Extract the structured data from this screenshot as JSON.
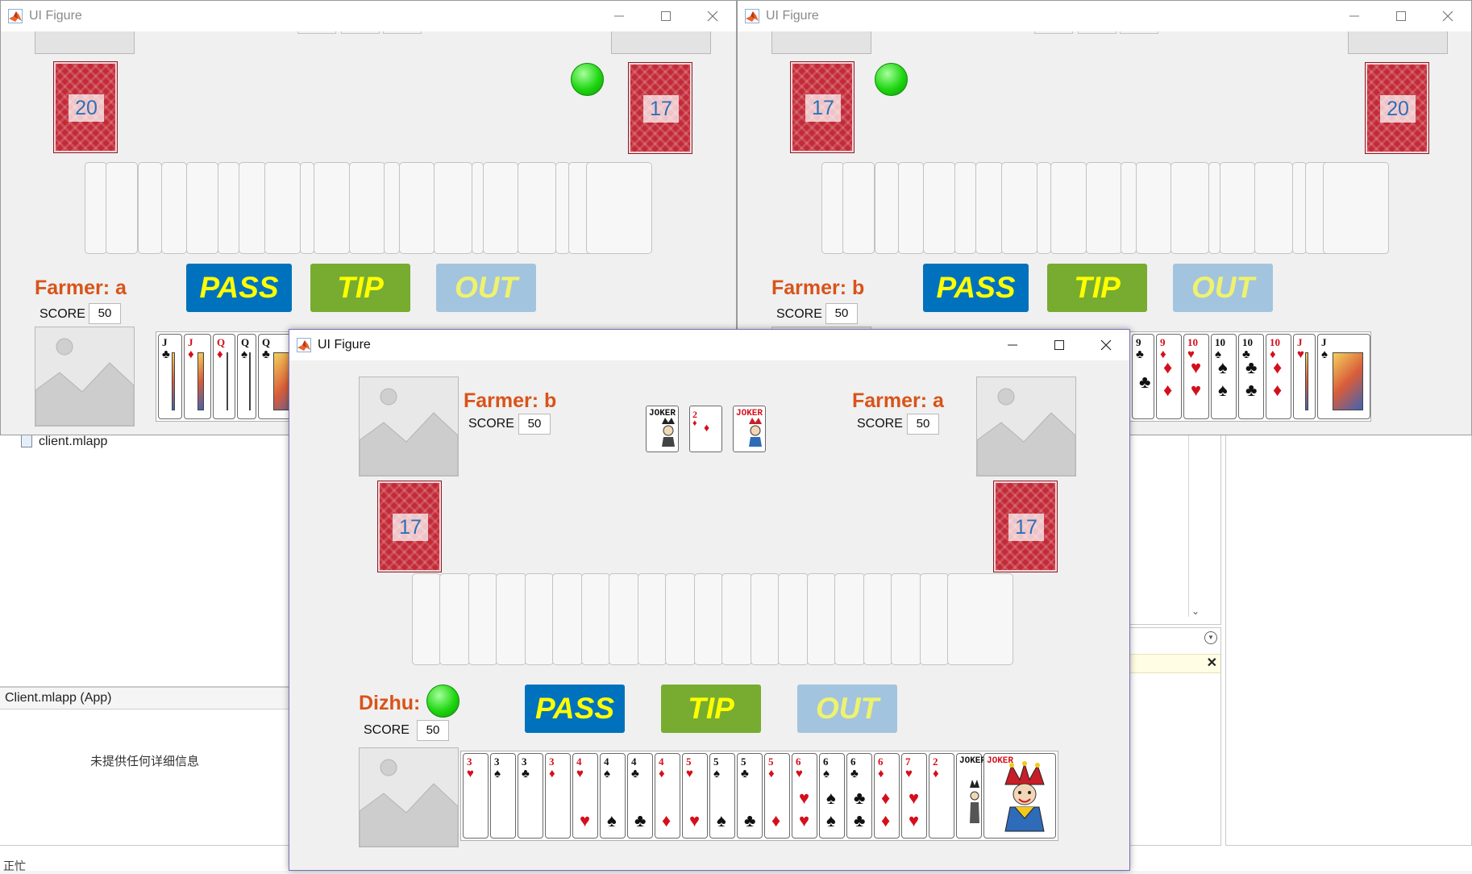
{
  "ide": {
    "file_item": "client.mlapp",
    "details_header": "Client.mlapp  (App)",
    "details_text": "未提供任何详细信息",
    "status": "正忙"
  },
  "windows": {
    "left": {
      "title": "UI Figure",
      "player_role": "Farmer: a",
      "score_label": "SCORE",
      "score_value": "50",
      "opponent_left_count": "20",
      "opponent_right_count": "17",
      "buttons": {
        "pass": "PASS",
        "tip": "TIP",
        "out": "OUT"
      },
      "hand_cards": [
        {
          "rank": "J",
          "suit": "♣",
          "color": "black"
        },
        {
          "rank": "J",
          "suit": "♦",
          "color": "red"
        },
        {
          "rank": "Q",
          "suit": "♦",
          "color": "red"
        },
        {
          "rank": "Q",
          "suit": "♠",
          "color": "black"
        },
        {
          "rank": "Q",
          "suit": "♣",
          "color": "black"
        }
      ]
    },
    "right": {
      "title": "UI Figure",
      "player_role": "Farmer: b",
      "score_label": "SCORE",
      "score_value": "50",
      "opponent_left_count": "17",
      "opponent_right_count": "20",
      "buttons": {
        "pass": "PASS",
        "tip": "TIP",
        "out": "OUT"
      },
      "hand_cards": [
        {
          "rank": "9",
          "suit": "♣",
          "color": "black"
        },
        {
          "rank": "9",
          "suit": "♦",
          "color": "red"
        },
        {
          "rank": "10",
          "suit": "♥",
          "color": "red"
        },
        {
          "rank": "10",
          "suit": "♠",
          "color": "black"
        },
        {
          "rank": "10",
          "suit": "♣",
          "color": "black"
        },
        {
          "rank": "10",
          "suit": "♦",
          "color": "red"
        },
        {
          "rank": "J",
          "suit": "♥",
          "color": "red"
        },
        {
          "rank": "J",
          "suit": "♠",
          "color": "black"
        }
      ]
    },
    "main": {
      "title": "UI Figure",
      "left_opponent": {
        "role": "Farmer: b",
        "score_label": "SCORE",
        "score_value": "50",
        "card_count": "17"
      },
      "right_opponent": {
        "role": "Farmer: a",
        "score_label": "SCORE",
        "score_value": "50",
        "card_count": "17"
      },
      "played_cards": [
        {
          "rank": "JOKER",
          "suit": "",
          "color": "black"
        },
        {
          "rank": "2",
          "suit": "♦",
          "color": "red"
        },
        {
          "rank": "JOKER",
          "suit": "",
          "color": "red"
        }
      ],
      "player": {
        "role": "Dizhu:",
        "score_label": "SCORE",
        "score_value": "50"
      },
      "buttons": {
        "pass": "PASS",
        "tip": "TIP",
        "out": "OUT"
      },
      "hand_cards": [
        {
          "rank": "3",
          "suit": "♥",
          "color": "red"
        },
        {
          "rank": "3",
          "suit": "♠",
          "color": "black"
        },
        {
          "rank": "3",
          "suit": "♣",
          "color": "black"
        },
        {
          "rank": "3",
          "suit": "♦",
          "color": "red"
        },
        {
          "rank": "4",
          "suit": "♥",
          "color": "red"
        },
        {
          "rank": "4",
          "suit": "♠",
          "color": "black"
        },
        {
          "rank": "4",
          "suit": "♣",
          "color": "black"
        },
        {
          "rank": "4",
          "suit": "♦",
          "color": "red"
        },
        {
          "rank": "5",
          "suit": "♥",
          "color": "red"
        },
        {
          "rank": "5",
          "suit": "♠",
          "color": "black"
        },
        {
          "rank": "5",
          "suit": "♣",
          "color": "black"
        },
        {
          "rank": "5",
          "suit": "♦",
          "color": "red"
        },
        {
          "rank": "6",
          "suit": "♥",
          "color": "red"
        },
        {
          "rank": "6",
          "suit": "♠",
          "color": "black"
        },
        {
          "rank": "6",
          "suit": "♣",
          "color": "black"
        },
        {
          "rank": "6",
          "suit": "♦",
          "color": "red"
        },
        {
          "rank": "7",
          "suit": "♥",
          "color": "red"
        },
        {
          "rank": "2",
          "suit": "♦",
          "color": "red"
        },
        {
          "rank": "JOKER",
          "suit": "",
          "color": "black"
        },
        {
          "rank": "JOKER",
          "suit": "",
          "color": "red"
        }
      ]
    }
  },
  "colors": {
    "role_text": "#d95319",
    "pass_button": "#0072bd",
    "tip_button": "#77ac30",
    "out_button": "#a3c4de",
    "button_text": "#ffff00",
    "card_count_text": "#2d6fb6",
    "card_back": "#c32a37",
    "dizhu_indicator": "#1fd611"
  }
}
